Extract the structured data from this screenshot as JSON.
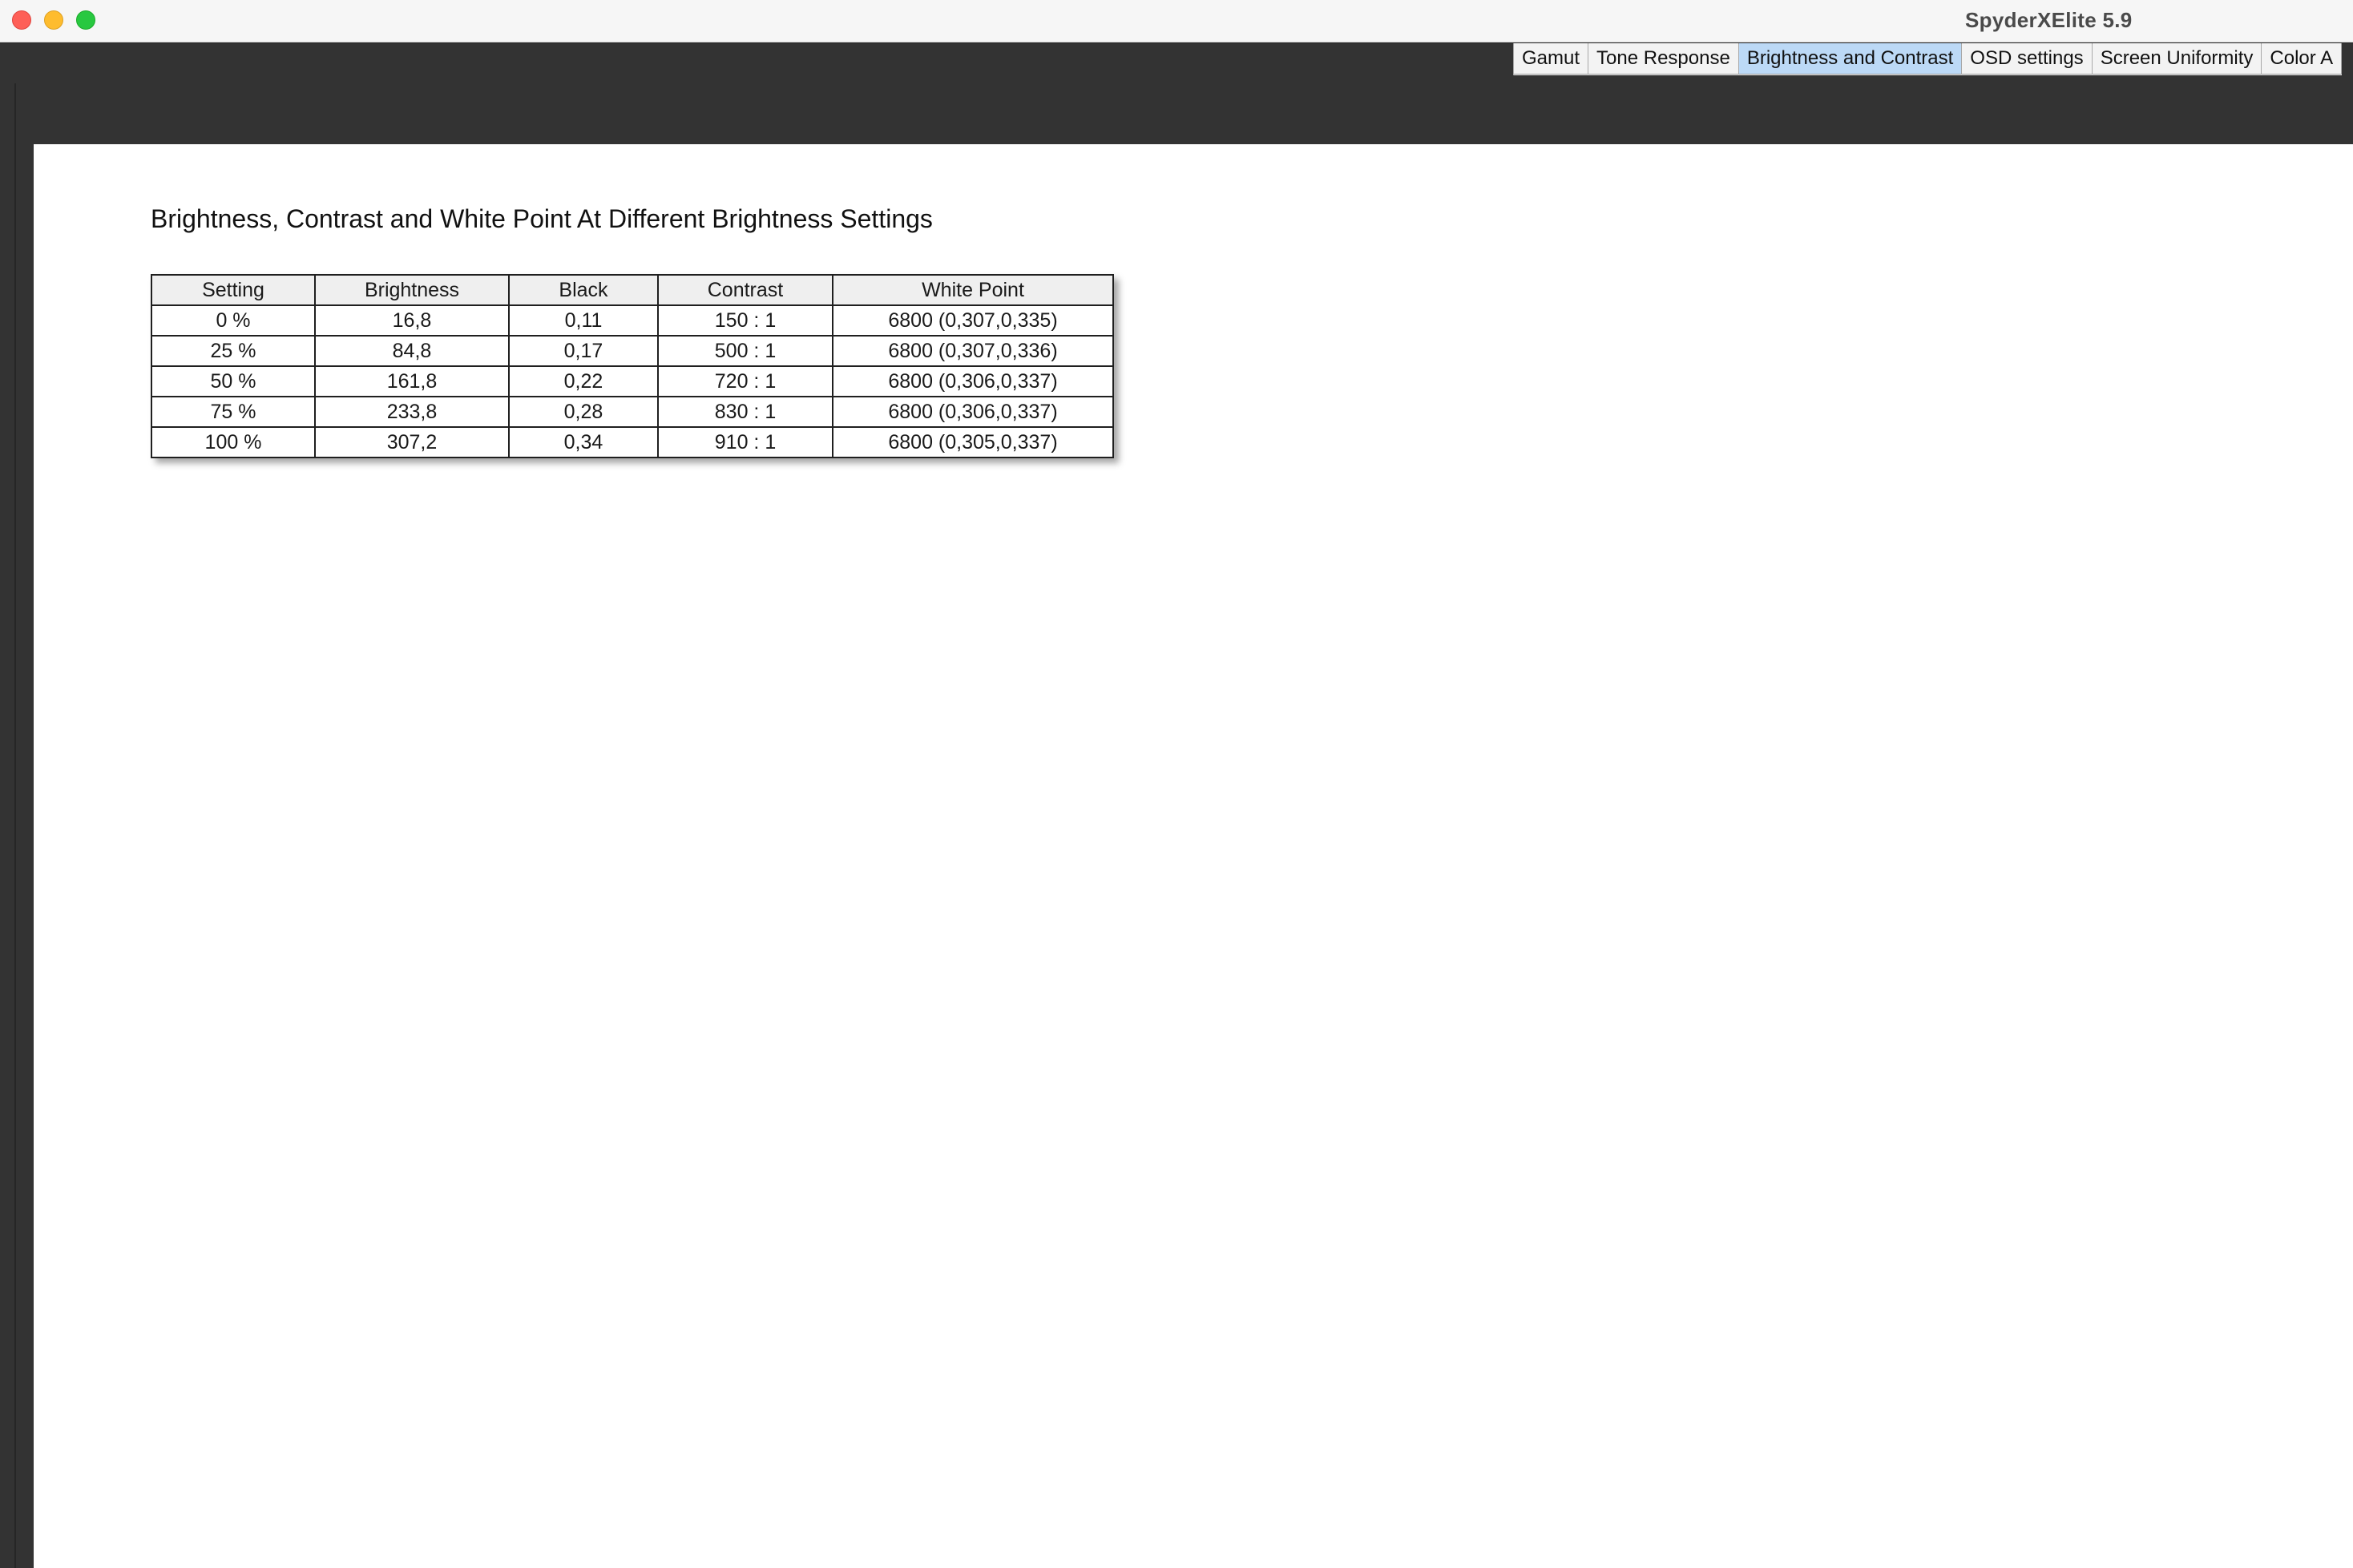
{
  "window": {
    "title": "SpyderXElite 5.9"
  },
  "tabs": [
    {
      "label": "Gamut",
      "active": false
    },
    {
      "label": "Tone Response",
      "active": false
    },
    {
      "label": "Brightness and Contrast",
      "active": true
    },
    {
      "label": "OSD settings",
      "active": false
    },
    {
      "label": "Screen Uniformity",
      "active": false
    },
    {
      "label": "Color A",
      "active": false
    }
  ],
  "report": {
    "title": "Brightness, Contrast and White Point At Different Brightness Settings",
    "columns": [
      "Setting",
      "Brightness",
      "Black",
      "Contrast",
      "White Point"
    ],
    "rows": [
      [
        "0 %",
        "16,8",
        "0,11",
        "150 : 1",
        "6800 (0,307,0,335)"
      ],
      [
        "25 %",
        "84,8",
        "0,17",
        "500 : 1",
        "6800 (0,307,0,336)"
      ],
      [
        "50 %",
        "161,8",
        "0,22",
        "720 : 1",
        "6800 (0,306,0,337)"
      ],
      [
        "75 %",
        "233,8",
        "0,28",
        "830 : 1",
        "6800 (0,306,0,337)"
      ],
      [
        "100 %",
        "307,2",
        "0,34",
        "910 : 1",
        "6800 (0,305,0,337)"
      ]
    ]
  },
  "colors": {
    "active_tab": "#bcd9f6",
    "toolbar": "#333333",
    "traffic_close": "#fe5f57",
    "traffic_minimize": "#febc2e",
    "traffic_maximize": "#28c840"
  }
}
